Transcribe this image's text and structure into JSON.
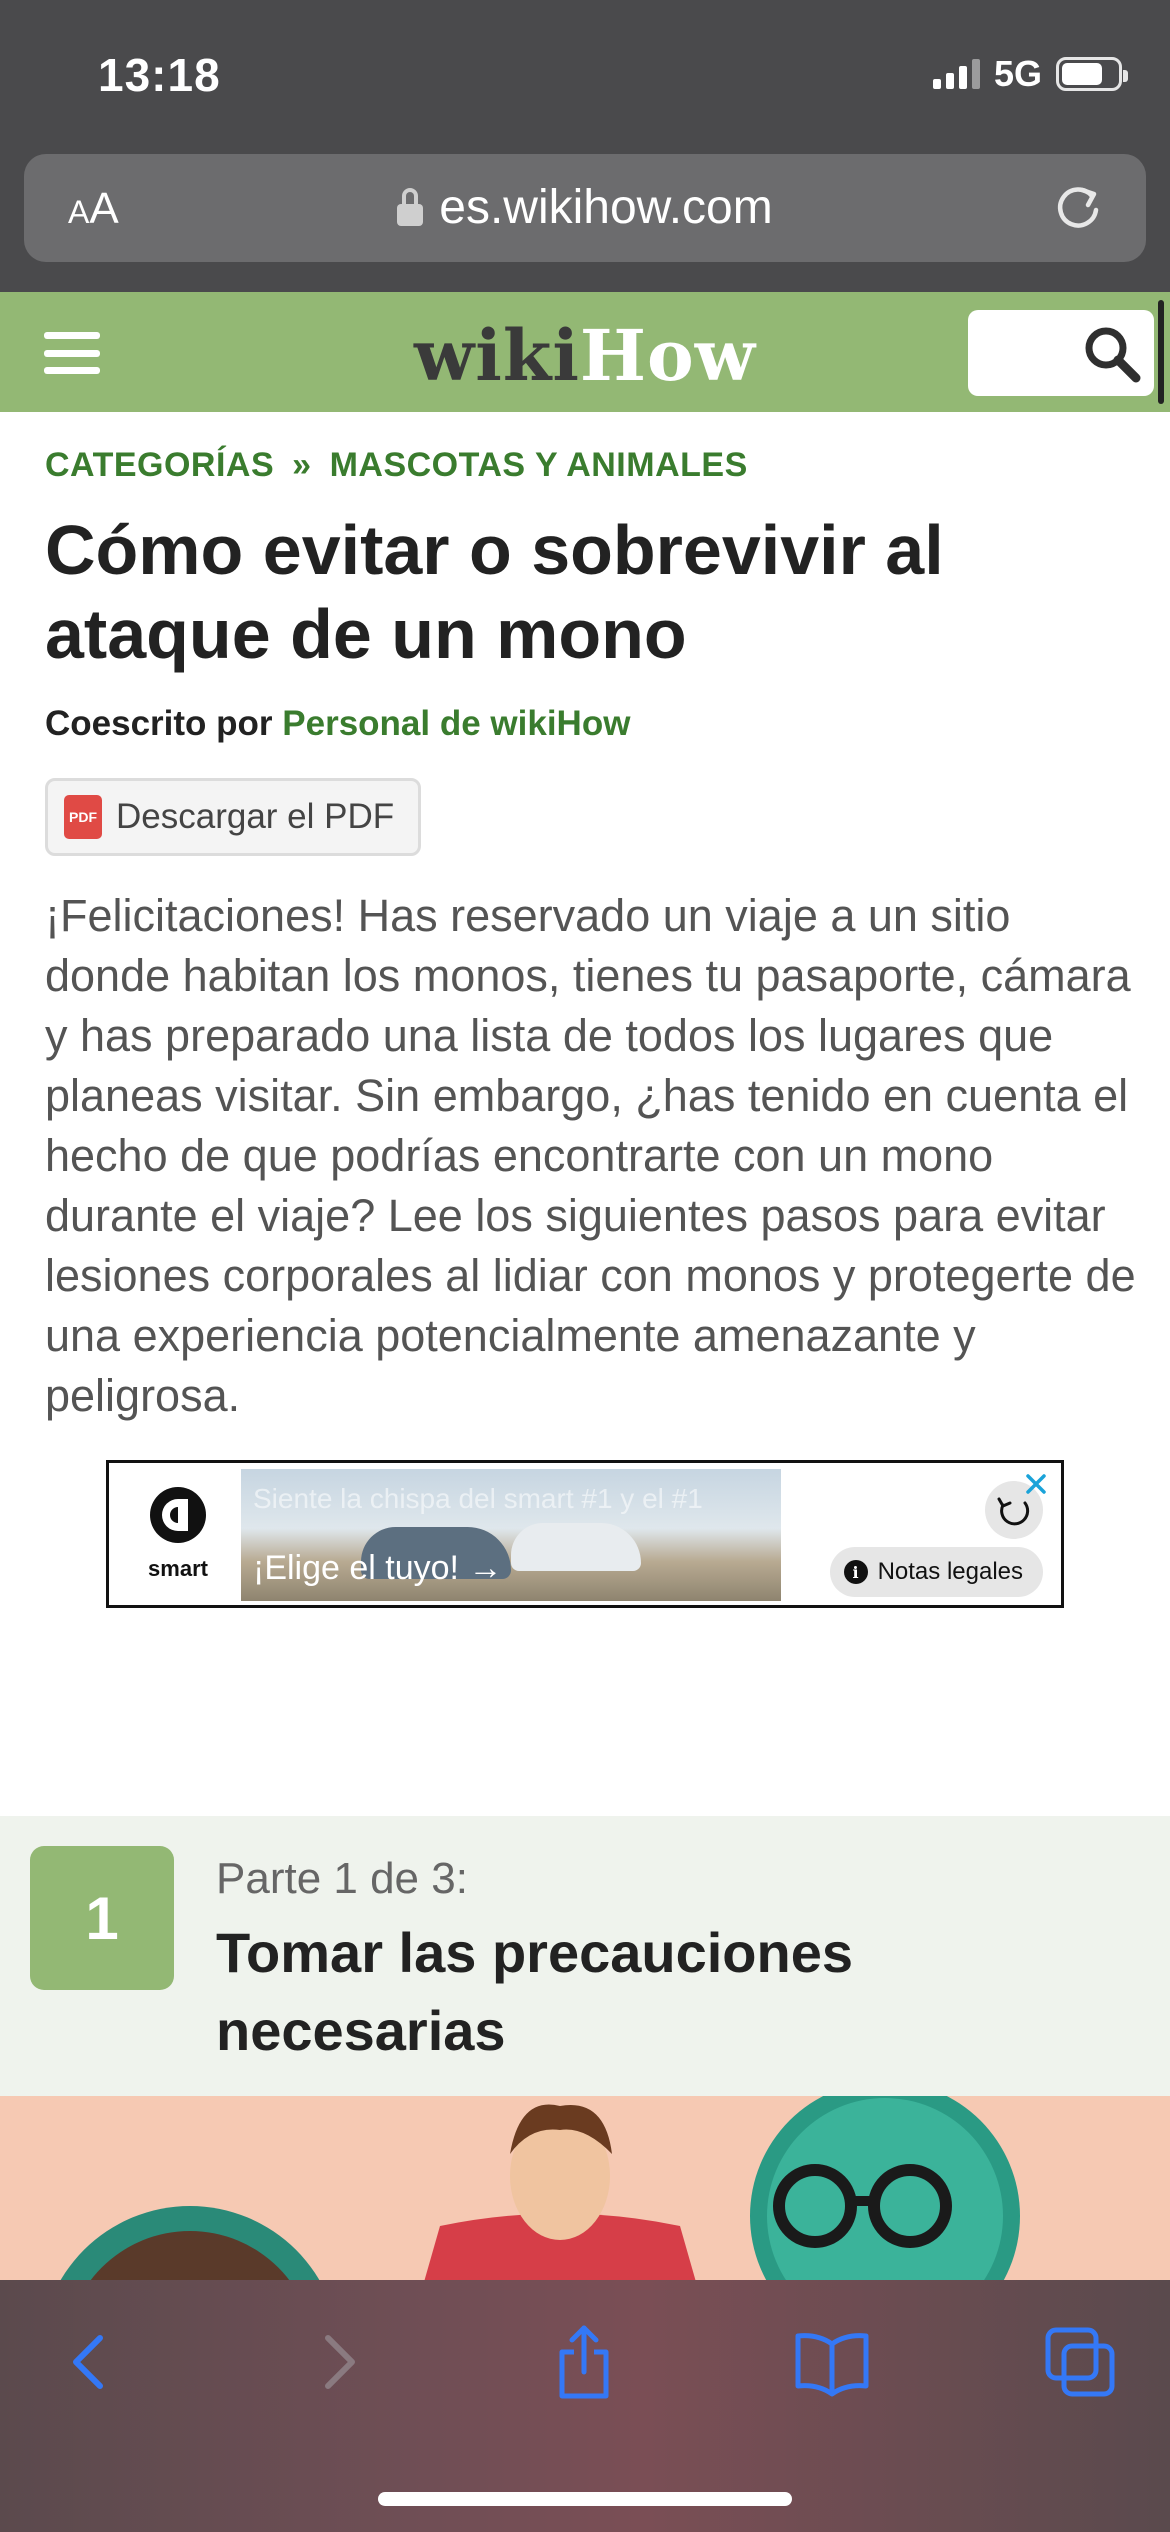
{
  "status_bar": {
    "time": "13:18",
    "network": "5G"
  },
  "browser": {
    "text_size_small": "A",
    "text_size_large": "A",
    "url": "es.wikihow.com"
  },
  "site": {
    "logo_part1": "wiki",
    "logo_part2": "How"
  },
  "breadcrumb": {
    "category": "CATEGORÍAS",
    "separator": "»",
    "subcategory": "MASCOTAS Y ANIMALES"
  },
  "article": {
    "title": "Cómo evitar o sobrevivir al ataque de un mono",
    "byline_prefix": "Coescrito por",
    "author": "Personal de wikiHow",
    "pdf_icon_text": "PDF",
    "pdf_button": "Descargar el PDF",
    "intro": "¡Felicitaciones! Has reservado un viaje a un sitio donde habitan los monos, tienes tu pasaporte, cámara y has preparado una lista de todos los lugares que planeas visitar. Sin embargo, ¿has tenido en cuenta el hecho de que podrías encontrarte con un mono durante el viaje? Lee los siguientes pasos para evitar lesiones corporales al lidiar con monos y protegerte de una experiencia potencialmente amenazante y peligrosa."
  },
  "ad": {
    "brand": "smart",
    "caption": "Siente la chispa del smart #1 y el #1",
    "cta": "¡Elige el tuyo! →",
    "legal": "Notas legales",
    "info_glyph": "i"
  },
  "section": {
    "number": "1",
    "part": "Parte 1 de 3:",
    "title": "Tomar las precauciones necesarias"
  },
  "colors": {
    "wikihow_green": "#93b874",
    "link_green": "#3a7c2e",
    "ios_blue": "#3478f6"
  },
  "icons": [
    "lock-icon",
    "reload-icon",
    "hamburger-icon",
    "search-icon",
    "pdf-icon",
    "close-icon",
    "refresh-icon",
    "info-icon",
    "back-icon",
    "forward-icon",
    "share-icon",
    "bookmarks-icon",
    "tabs-icon"
  ]
}
